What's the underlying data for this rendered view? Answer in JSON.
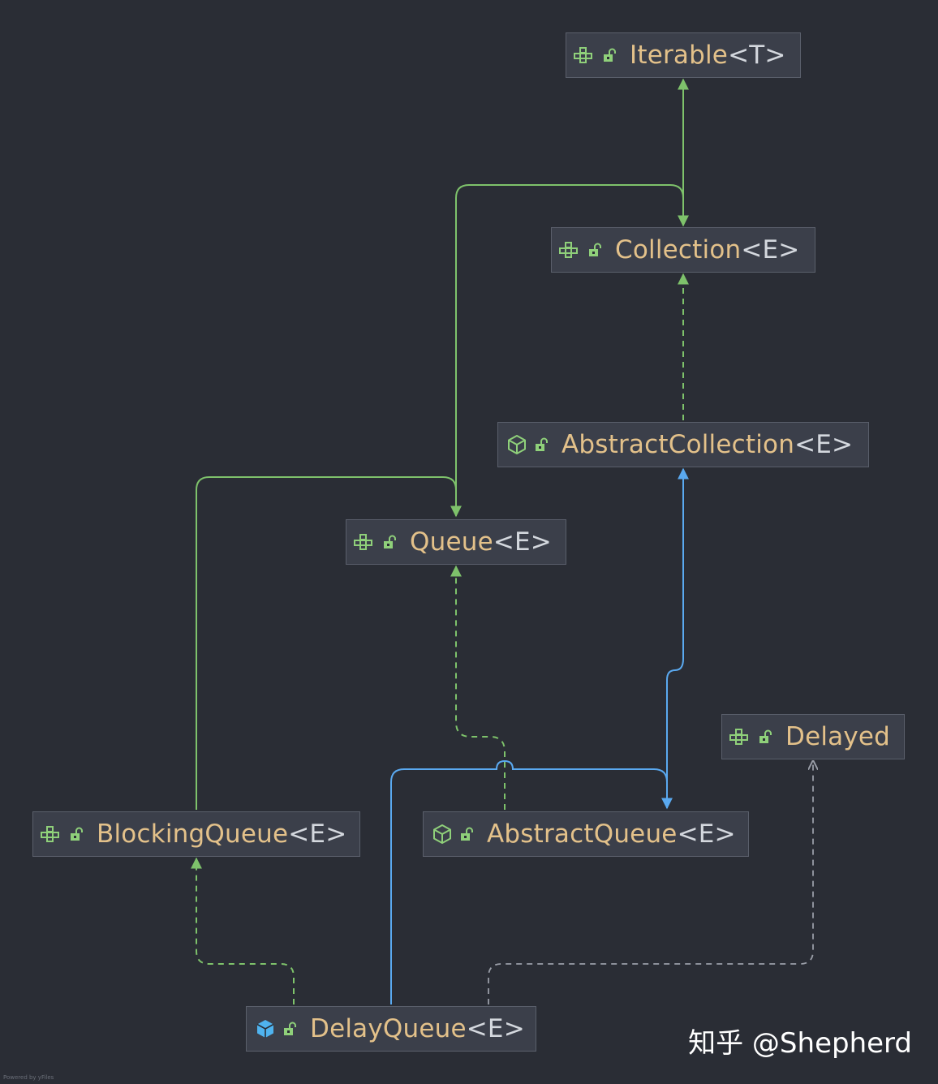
{
  "nodes": [
    {
      "id": "iterable",
      "name": "Iterable",
      "generic": "<T>",
      "kind": "interface"
    },
    {
      "id": "collection",
      "name": "Collection",
      "generic": "<E>",
      "kind": "interface"
    },
    {
      "id": "abstractcollection",
      "name": "AbstractCollection",
      "generic": "<E>",
      "kind": "abstract-class"
    },
    {
      "id": "queue",
      "name": "Queue",
      "generic": "<E>",
      "kind": "interface"
    },
    {
      "id": "delayed",
      "name": "Delayed",
      "generic": "",
      "kind": "interface"
    },
    {
      "id": "blockingqueue",
      "name": "BlockingQueue",
      "generic": "<E>",
      "kind": "interface"
    },
    {
      "id": "abstractqueue",
      "name": "AbstractQueue",
      "generic": "<E>",
      "kind": "abstract-class"
    },
    {
      "id": "delayqueue",
      "name": "DelayQueue",
      "generic": "<E>",
      "kind": "class"
    }
  ],
  "edges": [
    {
      "from": "collection",
      "to": "iterable",
      "type": "extends-interface"
    },
    {
      "from": "queue",
      "to": "collection",
      "type": "extends-interface"
    },
    {
      "from": "abstractcollection",
      "to": "collection",
      "type": "implements"
    },
    {
      "from": "blockingqueue",
      "to": "queue",
      "type": "extends-interface"
    },
    {
      "from": "abstractqueue",
      "to": "queue",
      "type": "implements"
    },
    {
      "from": "abstractqueue",
      "to": "abstractcollection",
      "type": "extends-class"
    },
    {
      "from": "delayqueue",
      "to": "blockingqueue",
      "type": "implements"
    },
    {
      "from": "delayqueue",
      "to": "abstractqueue",
      "type": "extends-class"
    },
    {
      "from": "delayqueue",
      "to": "delayed",
      "type": "dependency"
    }
  ],
  "icons": {
    "interface": "interface-icon",
    "abstract-class": "abstract-class-icon",
    "class": "class-icon",
    "lock": "unlocked-icon"
  },
  "colors": {
    "background": "#2a2d35",
    "interface_edge": "#7ec26b",
    "class_edge": "#5aa9f0",
    "dependency_edge": "#9a9ea8",
    "label": "#e3c18a"
  },
  "watermark": "知乎 @Shepherd",
  "powered_by": "Powered by yFiles"
}
